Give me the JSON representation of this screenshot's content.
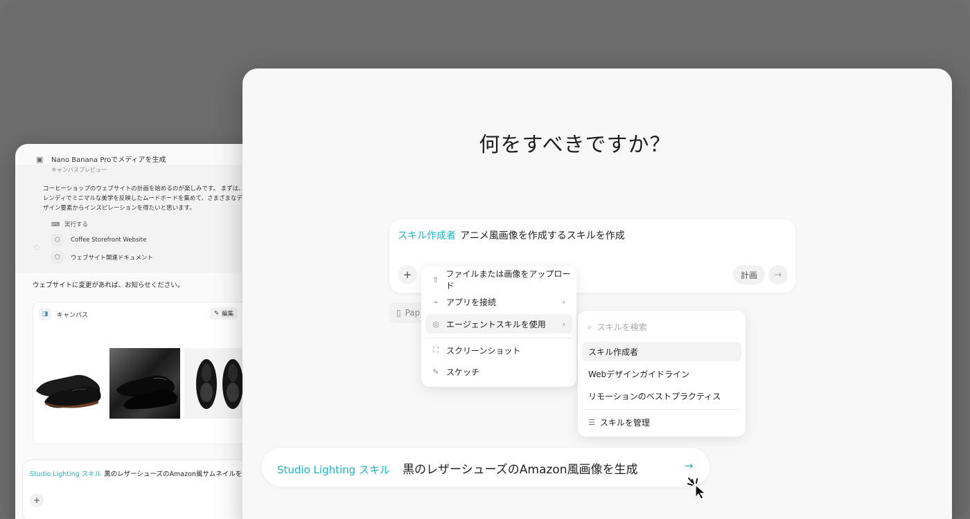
{
  "colors": {
    "accent": "#1cb6c9",
    "background": "#6f6f6f"
  },
  "back_window": {
    "task_title": "Nano Banana Proでメディアを生成",
    "task_subtitle": "キャンバスプレビュー",
    "message": "コーヒーショップのウェブサイトの計画を始めるのが楽しみです。 まずは、\nレンディでミニマルな美学を反映したムードボードを集めて、さまざまなデ\nザイン要素からインスピレーションを得たいと思います。",
    "run_label": "実行する",
    "items": [
      {
        "label": "Coffee Storefront Website",
        "icon": "cube-icon"
      },
      {
        "label": "ウェブサイト関連ドキュメント",
        "icon": "cube-icon"
      }
    ],
    "notify_text": "ウェブサイトに変更があれば、お知らせください。",
    "canvas": {
      "title": "キャンバス",
      "edit_label": "編集",
      "more_label": "⋮"
    },
    "chat_input": {
      "skill": "Studio Lighting スキル",
      "text": "黒のレザーシューズのAmazon風サムネイルを作成"
    }
  },
  "front_window": {
    "heading": "何をすべきですか？",
    "prompt": {
      "skill": "スキル作成者",
      "text": "アニメ風画像を作成するスキルを作成",
      "plan_label": "計画"
    },
    "page_chip": "Pap",
    "menu": [
      {
        "label": "ファイルまたは画像をアップロード",
        "icon": "upload-icon"
      },
      {
        "label": "アプリを接続",
        "icon": "plug-icon",
        "submenu": true
      },
      {
        "label": "エージェントスキルを使用",
        "icon": "skill-icon",
        "submenu": true,
        "active": true
      },
      {
        "label": "スクリーンショット",
        "icon": "screenshot-icon"
      },
      {
        "label": "スケッチ",
        "icon": "pencil-icon"
      }
    ],
    "submenu": {
      "search_placeholder": "スキルを検索",
      "items": [
        {
          "label": "スキル作成者",
          "active": true
        },
        {
          "label": "Webデザインガイドライン"
        },
        {
          "label": "リモーションのベストプラクティス"
        }
      ],
      "manage_label": "スキルを管理"
    },
    "bottom_bar": {
      "skill": "Studio Lighting スキル",
      "text": "黒のレザーシューズのAmazon風画像を生成"
    }
  }
}
